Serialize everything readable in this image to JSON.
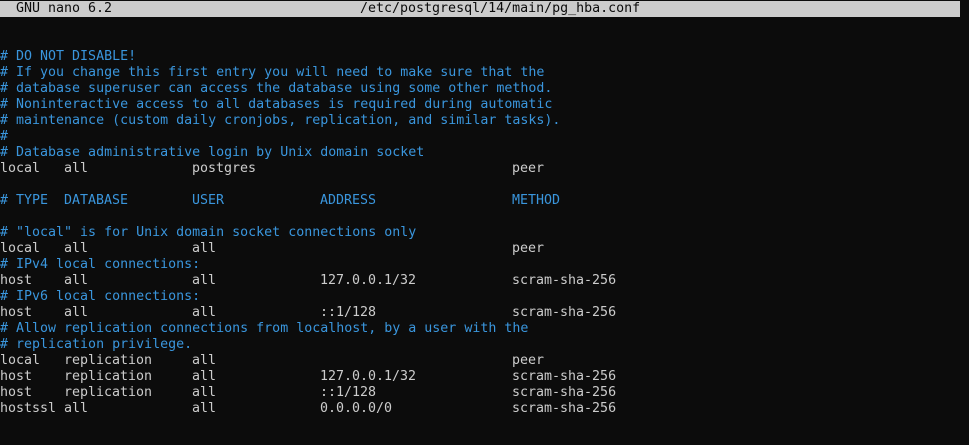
{
  "titlebar": {
    "app": "GNU nano 6.2",
    "filename": "/etc/postgresql/14/main/pg_hba.conf"
  },
  "lines": [
    {
      "type": "comment",
      "text": "# DO NOT DISABLE!"
    },
    {
      "type": "comment",
      "text": "# If you change this first entry you will need to make sure that the"
    },
    {
      "type": "comment",
      "text": "# database superuser can access the database using some other method."
    },
    {
      "type": "comment",
      "text": "# Noninteractive access to all databases is required during automatic"
    },
    {
      "type": "comment",
      "text": "# maintenance (custom daily cronjobs, replication, and similar tasks)."
    },
    {
      "type": "comment",
      "text": "#"
    },
    {
      "type": "comment",
      "text": "# Database administrative login by Unix domain socket"
    },
    {
      "type": "entry",
      "cols": [
        "local",
        "all",
        "postgres",
        "",
        "peer"
      ]
    },
    {
      "type": "blank"
    },
    {
      "type": "header",
      "cols": [
        "# TYPE",
        "DATABASE",
        "USER",
        "ADDRESS",
        "METHOD"
      ]
    },
    {
      "type": "blank"
    },
    {
      "type": "comment",
      "text": "# \"local\" is for Unix domain socket connections only"
    },
    {
      "type": "entry",
      "cols": [
        "local",
        "all",
        "all",
        "",
        "peer"
      ]
    },
    {
      "type": "comment",
      "text": "# IPv4 local connections:"
    },
    {
      "type": "entry",
      "cols": [
        "host",
        "all",
        "all",
        "127.0.0.1/32",
        "scram-sha-256"
      ]
    },
    {
      "type": "comment",
      "text": "# IPv6 local connections:"
    },
    {
      "type": "entry",
      "cols": [
        "host",
        "all",
        "all",
        "::1/128",
        "scram-sha-256"
      ]
    },
    {
      "type": "comment",
      "text": "# Allow replication connections from localhost, by a user with the"
    },
    {
      "type": "comment",
      "text": "# replication privilege."
    },
    {
      "type": "entry",
      "cols": [
        "local",
        "replication",
        "all",
        "",
        "peer"
      ]
    },
    {
      "type": "entry",
      "cols": [
        "host",
        "replication",
        "all",
        "127.0.0.1/32",
        "scram-sha-256"
      ]
    },
    {
      "type": "entry",
      "cols": [
        "host",
        "replication",
        "all",
        "::1/128",
        "scram-sha-256"
      ]
    },
    {
      "type": "entry",
      "cols": [
        "hostssl",
        "all",
        "all",
        "0.0.0.0/0",
        "scram-sha-256"
      ]
    }
  ],
  "colors": {
    "background": "#0c0c0c",
    "text": "#cccccc",
    "comment": "#3a96dd",
    "titlebar_bg": "#cccccc"
  }
}
